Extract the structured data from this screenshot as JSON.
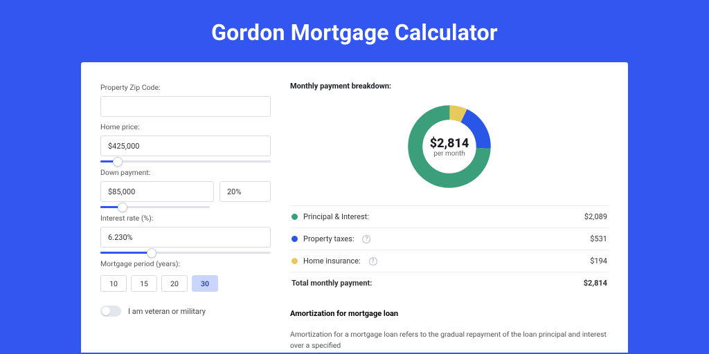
{
  "title": "Gordon Mortgage Calculator",
  "form": {
    "zip_label": "Property Zip Code:",
    "zip_value": "",
    "price_label": "Home price:",
    "price_value": "$425,000",
    "price_slider_pct": 10,
    "down_label": "Down payment:",
    "down_value": "$85,000",
    "down_pct": "20%",
    "down_slider_pct": 20,
    "rate_label": "Interest rate (%):",
    "rate_value": "6.230%",
    "rate_slider_pct": 30,
    "period_label": "Mortgage period (years):",
    "periods": [
      "10",
      "15",
      "20",
      "30"
    ],
    "period_selected": "30",
    "veteran_label": "I am veteran or military",
    "veteran_on": false
  },
  "breakdown": {
    "title": "Monthly payment breakdown:",
    "center_amount": "$2,814",
    "center_sub": "per month",
    "items": [
      {
        "label": "Principal & Interest:",
        "value": "$2,089",
        "color": "#3a9f7a"
      },
      {
        "label": "Property taxes:",
        "value": "$531",
        "color": "#2a56e8",
        "info": true
      },
      {
        "label": "Home insurance:",
        "value": "$194",
        "color": "#e7c95c",
        "info": true
      }
    ],
    "total_label": "Total monthly payment:",
    "total_value": "$2,814"
  },
  "amort": {
    "title": "Amortization for mortgage loan",
    "body": "Amortization for a mortgage loan refers to the gradual repayment of the loan principal and interest over a specified"
  },
  "chart_data": {
    "type": "pie",
    "title": "Monthly payment breakdown",
    "total": 2814,
    "series": [
      {
        "name": "Principal & Interest",
        "value": 2089,
        "color": "#3a9f7a"
      },
      {
        "name": "Property taxes",
        "value": 531,
        "color": "#2a56e8"
      },
      {
        "name": "Home insurance",
        "value": 194,
        "color": "#e7c95c"
      }
    ]
  }
}
